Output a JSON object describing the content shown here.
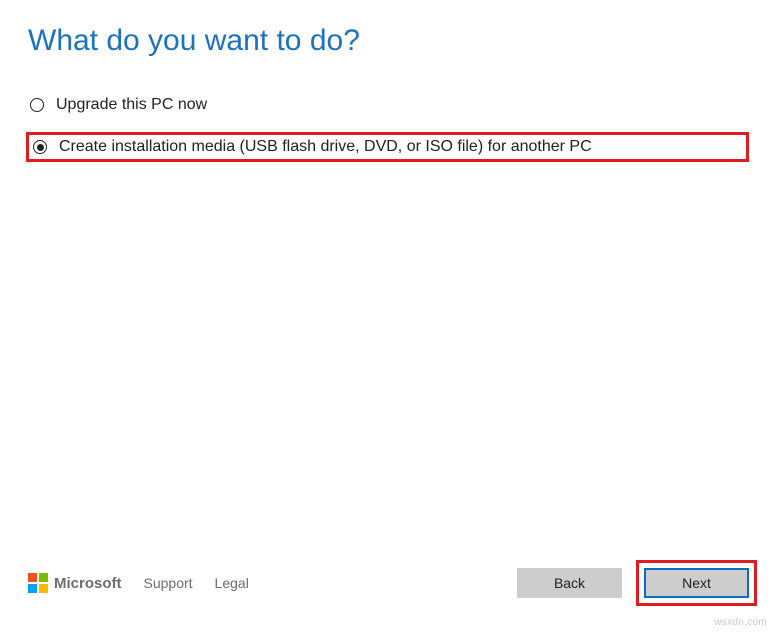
{
  "title": "What do you want to do?",
  "options": [
    {
      "label": "Upgrade this PC now",
      "selected": false
    },
    {
      "label": "Create installation media (USB flash drive, DVD, or ISO file) for another PC",
      "selected": true
    }
  ],
  "footer": {
    "brand": "Microsoft",
    "support": "Support",
    "legal": "Legal"
  },
  "buttons": {
    "back": "Back",
    "next": "Next"
  },
  "watermark": "wsxdn.com"
}
